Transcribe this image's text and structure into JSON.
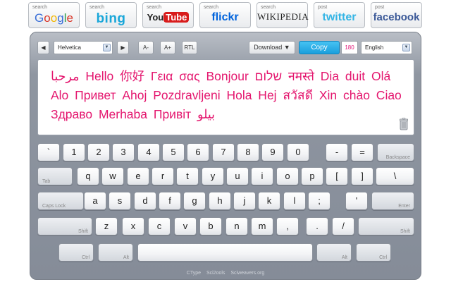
{
  "search_buttons": [
    {
      "small": "search",
      "name": "Google"
    },
    {
      "small": "search",
      "name": "bing"
    },
    {
      "small": "search",
      "name": "YouTube"
    },
    {
      "small": "search",
      "name": "flickr"
    },
    {
      "small": "search",
      "name": "Wikipedia"
    },
    {
      "small": "post",
      "name": "twitter"
    },
    {
      "small": "post",
      "name": "facebook"
    }
  ],
  "toolbar": {
    "prev_glyph": "◀",
    "next_glyph": "▶",
    "font_value": "Helvetica",
    "font_smaller": "A-",
    "font_larger": "A+",
    "rtl": "RTL",
    "download": "Download ▼",
    "copy": "Copy",
    "char_count": "180",
    "language_value": "English"
  },
  "text": "مرحبا Hello 你好 Γεια σας Bonjour שלום नमस्ते Dia duit Olá Alo Привет Ahoj Pozdravljeni Hola Hej สวัสดี Xin chào Ciao Здраво Merhaba Привіт بيلو",
  "keyboard": {
    "row1": [
      "`",
      "1",
      "2",
      "3",
      "4",
      "5",
      "6",
      "7",
      "8",
      "9",
      "0",
      "-",
      "="
    ],
    "backspace": "Backspace",
    "tab": "Tab",
    "row2": [
      "q",
      "w",
      "e",
      "r",
      "t",
      "y",
      "u",
      "i",
      "o",
      "p",
      "[",
      "]",
      "\\"
    ],
    "caps": "Caps Lock",
    "row3": [
      "a",
      "s",
      "d",
      "f",
      "g",
      "h",
      "j",
      "k",
      "l",
      ";",
      "'"
    ],
    "enter": "Enter",
    "shift_left": "Shift",
    "row4": [
      "z",
      "x",
      "c",
      "v",
      "b",
      "n",
      "m",
      ",",
      ".",
      "/"
    ],
    "shift_right": "Shift",
    "ctrl_left": "Ctrl",
    "alt_left": "Alt",
    "alt_right": "Alt",
    "ctrl_right": "Ctrl"
  },
  "footer": [
    "CType",
    "Sci2ools",
    "Sciweavers.org"
  ],
  "colors": {
    "text": "#e4166e",
    "copy_button": "#1a9fdd",
    "char_count": "#e0187a"
  }
}
